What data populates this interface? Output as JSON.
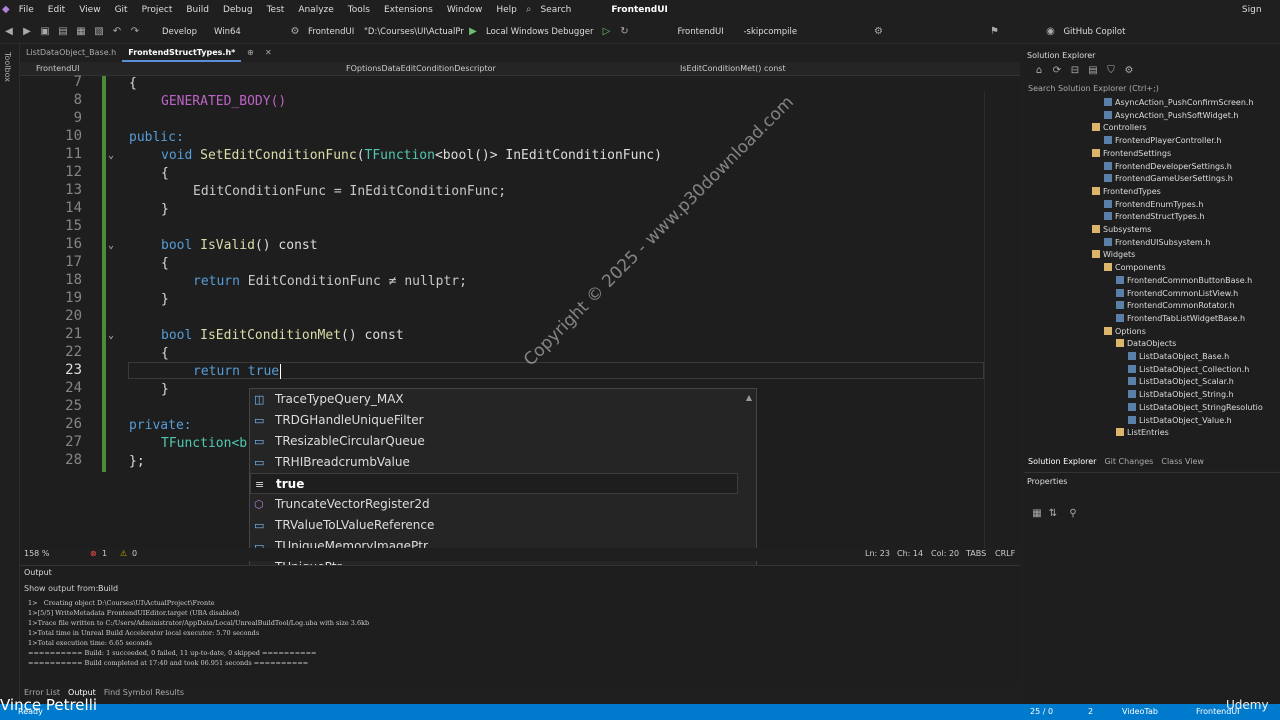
{
  "menu": [
    "File",
    "Edit",
    "View",
    "Git",
    "Project",
    "Build",
    "Debug",
    "Test",
    "Analyze",
    "Tools",
    "Extensions",
    "Window",
    "Help"
  ],
  "search_label": "Search",
  "solution_title": "FrontendUI",
  "sign_in": "Sign in",
  "toolbar": {
    "config": "Develop",
    "platform": "Win64",
    "project": "FrontendUI",
    "path": "\"D:\\Courses\\UI\\ActualProje",
    "debugger": "Local Windows Debugger",
    "target": "FrontendUI",
    "args": "-skipcompile",
    "copilot": "GitHub Copilot"
  },
  "toolbox_label": "Toolbox",
  "tabs": [
    {
      "label": "ListDataObject_Base.h",
      "active": false
    },
    {
      "label": "FrontendStructTypes.h*",
      "active": true
    }
  ],
  "nav": {
    "project": "FrontendUI",
    "scope": "FOptionsDataEditConditionDescriptor",
    "member": "IsEditConditionMet() const"
  },
  "editor": {
    "line_numbers": [
      "7",
      "8",
      "9",
      "10",
      "11",
      "12",
      "13",
      "14",
      "15",
      "16",
      "17",
      "18",
      "19",
      "20",
      "21",
      "22",
      "23",
      "24",
      "25",
      "26",
      "27",
      "28"
    ],
    "current_line": "23",
    "code": {
      "l7": "{",
      "l8": "GENERATED_BODY()",
      "l10_kw": "public:",
      "l11_kw": "void",
      "l11_fn": "SetEditConditionFunc",
      "l11_ty": "TFunction",
      "l11_rest": "<bool()> InEditConditionFunc)",
      "l12": "{",
      "l13": "EditConditionFunc = InEditConditionFunc;",
      "l14": "}",
      "l16_kw": "bool",
      "l16_fn": "IsValid",
      "l16_rest": "() const",
      "l17": "{",
      "l18_kw": "return",
      "l18_rest": "EditConditionFunc ≠ nullptr;",
      "l19": "}",
      "l21_kw": "bool",
      "l21_fn": "IsEditConditionMet",
      "l21_rest": "() const",
      "l22": "{",
      "l23_kw": "return",
      "l23_typed": "true",
      "l24": "}",
      "l26_kw": "private:",
      "l27": "TFunction<b",
      "l28": "};"
    },
    "watermark": "Copyright © 2025 - www.p30download.com"
  },
  "completion": {
    "items": [
      {
        "label": "TraceTypeQuery_MAX",
        "icon": "enum-icon"
      },
      {
        "label": "TRDGHandleUniqueFilter",
        "icon": "struct-icon"
      },
      {
        "label": "TResizableCircularQueue",
        "icon": "struct-icon"
      },
      {
        "label": "TRHIBreadcrumbValue",
        "icon": "struct-icon"
      },
      {
        "label": "true",
        "icon": "keyword-icon"
      },
      {
        "label": "TruncateVectorRegister2d",
        "icon": "method-icon"
      },
      {
        "label": "TRValueToLValueReference",
        "icon": "struct-icon"
      },
      {
        "label": "TUniqueMemoryImagePtr",
        "icon": "struct-icon"
      },
      {
        "label": "TUniquePtr",
        "icon": "struct-icon"
      }
    ],
    "selected_index": 4
  },
  "editor_status": {
    "zoom": "158 %",
    "errors": "1",
    "warnings": "0",
    "ln": "Ln: 23",
    "ch": "Ch: 14",
    "col": "Col: 20",
    "tabs": "TABS",
    "eol": "CRLF"
  },
  "output": {
    "title": "Output",
    "show_from_label": "Show output from:",
    "show_from_value": "Build",
    "lines": [
      "1>   Creating object D:\\Courses\\UI\\ActualProject\\Fronte",
      "1>[5/5] WriteMetadata FrontendUIEditor.target (UBA disabled)",
      "1>Trace file written to C:/Users/Administrator/AppData/Local/UnrealBuildTool/Log.uba with size 3.6kb",
      "1>Total time in Unreal Build Accelerator local executor: 5.70 seconds",
      "1>Total execution time: 6.65 seconds",
      "========== Build: 1 succeeded, 0 failed, 11 up-to-date, 0 skipped ==========",
      "========== Build completed at 17:40 and took 06.951 seconds =========="
    ]
  },
  "bottom_tabs": [
    "Error List",
    "Output",
    "Find Symbol Results"
  ],
  "status": {
    "ready": "Ready",
    "git_lines": "25 / 0",
    "branch": "2",
    "repo": "VideoTab",
    "project": "FrontendUI"
  },
  "solution_explorer": {
    "title": "Solution Explorer",
    "search_placeholder": "Search Solution Explorer (Ctrl+;)",
    "tree": [
      {
        "label": "AsyncAction_PushConfirmScreen.h",
        "kind": "file",
        "depth": 6
      },
      {
        "label": "AsyncAction_PushSoftWidget.h",
        "kind": "file",
        "depth": 6
      },
      {
        "label": "Controllers",
        "kind": "folder",
        "depth": 5
      },
      {
        "label": "FrontendPlayerController.h",
        "kind": "file",
        "depth": 6
      },
      {
        "label": "FrontendSettings",
        "kind": "folder",
        "depth": 5
      },
      {
        "label": "FrontendDeveloperSettings.h",
        "kind": "file",
        "depth": 6
      },
      {
        "label": "FrontendGameUserSettings.h",
        "kind": "file",
        "depth": 6
      },
      {
        "label": "FrontendTypes",
        "kind": "folder",
        "depth": 5
      },
      {
        "label": "FrontendEnumTypes.h",
        "kind": "file",
        "depth": 6
      },
      {
        "label": "FrontendStructTypes.h",
        "kind": "file",
        "depth": 6
      },
      {
        "label": "Subsystems",
        "kind": "folder",
        "depth": 5
      },
      {
        "label": "FrontendUISubsystem.h",
        "kind": "file",
        "depth": 6
      },
      {
        "label": "Widgets",
        "kind": "folder",
        "depth": 5
      },
      {
        "label": "Components",
        "kind": "folder",
        "depth": 6
      },
      {
        "label": "FrontendCommonButtonBase.h",
        "kind": "file",
        "depth": 7
      },
      {
        "label": "FrontendCommonListView.h",
        "kind": "file",
        "depth": 7
      },
      {
        "label": "FrontendCommonRotator.h",
        "kind": "file",
        "depth": 7
      },
      {
        "label": "FrontendTabListWidgetBase.h",
        "kind": "file",
        "depth": 7
      },
      {
        "label": "Options",
        "kind": "folder",
        "depth": 6
      },
      {
        "label": "DataObjects",
        "kind": "folder",
        "depth": 7
      },
      {
        "label": "ListDataObject_Base.h",
        "kind": "file",
        "depth": 8
      },
      {
        "label": "ListDataObject_Collection.h",
        "kind": "file",
        "depth": 8
      },
      {
        "label": "ListDataObject_Scalar.h",
        "kind": "file",
        "depth": 8
      },
      {
        "label": "ListDataObject_String.h",
        "kind": "file",
        "depth": 8
      },
      {
        "label": "ListDataObject_StringResolutio",
        "kind": "file",
        "depth": 8
      },
      {
        "label": "ListDataObject_Value.h",
        "kind": "file",
        "depth": 8
      },
      {
        "label": "ListEntries",
        "kind": "folder",
        "depth": 7
      }
    ],
    "bottom_tabs": [
      "Solution Explorer",
      "Git Changes",
      "Class View"
    ]
  },
  "properties_title": "Properties",
  "presenter": "Vince Petrelli",
  "brand": "Udemy"
}
